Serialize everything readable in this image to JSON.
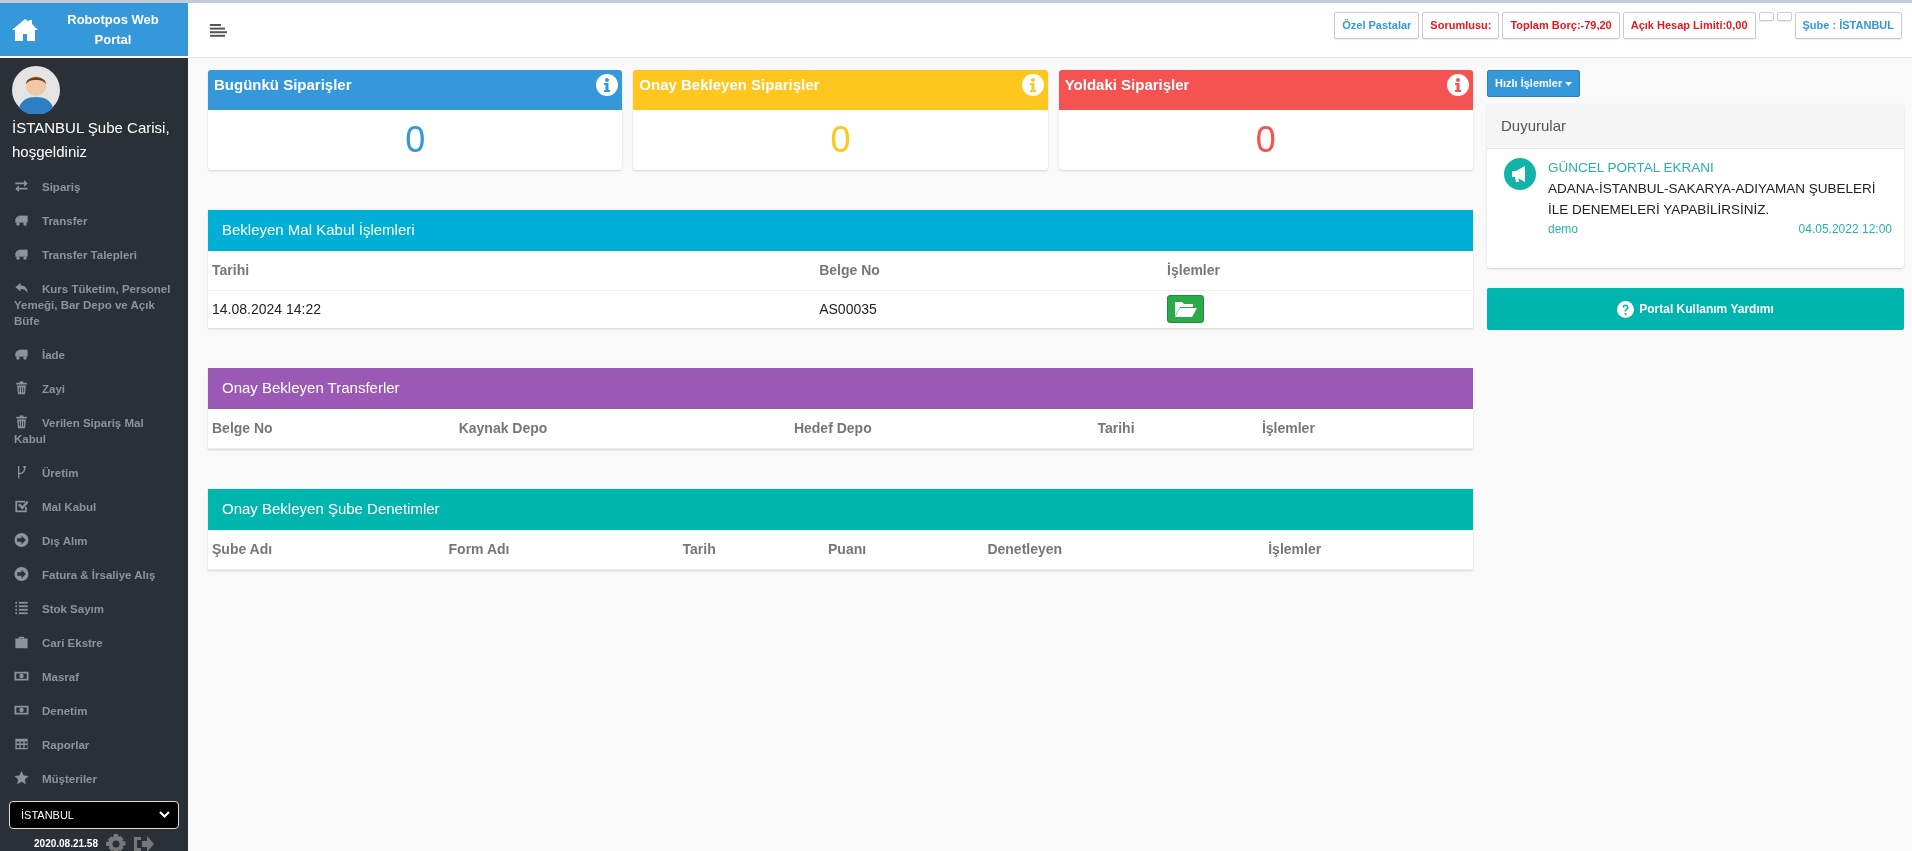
{
  "brand": {
    "title": "Robotpos Web Portal"
  },
  "profile": {
    "greeting": "İSTANBUL Şube Carisi, hoşgeldiniz"
  },
  "sidebar": {
    "items": [
      {
        "label": "Sipariş"
      },
      {
        "label": "Transfer"
      },
      {
        "label": "Transfer Talepleri"
      },
      {
        "label": "Kurs Tüketim, Personel Yemeği, Bar Depo ve Açık Büfe"
      },
      {
        "label": "İade"
      },
      {
        "label": "Zayi"
      },
      {
        "label": "Verilen Sipariş Mal Kabul"
      },
      {
        "label": "Üretim"
      },
      {
        "label": "Mal Kabul"
      },
      {
        "label": "Dış Alım"
      },
      {
        "label": "Fatura & İrsaliye Alış"
      },
      {
        "label": "Stok Sayım"
      },
      {
        "label": "Cari Ekstre"
      },
      {
        "label": "Masraf"
      },
      {
        "label": "Denetim"
      },
      {
        "label": "Raporlar"
      },
      {
        "label": "Müşteriler"
      }
    ],
    "branch_select": {
      "value": "İSTANBUL"
    },
    "version": "2020.08.21.58"
  },
  "header": {
    "buttons": [
      {
        "label": "Özel Pastalar",
        "kind": "info"
      },
      {
        "label": "Sorumlusu:",
        "kind": "alert"
      },
      {
        "label": "Toplam Borç:-79,20",
        "kind": "alert"
      },
      {
        "label": "Açık Hesap Limiti:0,00",
        "kind": "alert"
      },
      {
        "kind": "blank"
      },
      {
        "kind": "blank"
      },
      {
        "label": "Şube : İSTANBUL",
        "kind": "info"
      }
    ]
  },
  "stat_cards": [
    {
      "title": "Bugünkü Siparişler",
      "value": "0",
      "color": "#3498db"
    },
    {
      "title": "Onay Bekleyen Siparişler",
      "value": "0",
      "color": "#ffc61f"
    },
    {
      "title": "Yoldaki Siparişler",
      "value": "0",
      "color": "#f55252"
    }
  ],
  "tables": [
    {
      "title": "Bekleyen Mal Kabul İşlemleri",
      "color": "#00afd5",
      "columns": [
        "Tarihi",
        "Belge No",
        "İşlemler"
      ],
      "rows": [
        {
          "cells": [
            "14.08.2024 14:22",
            "AS00035"
          ]
        }
      ]
    },
    {
      "title": "Onay Bekleyen Transferler",
      "color": "#9b59b6",
      "columns": [
        "Belge No",
        "Kaynak Depo",
        "Hedef Depo",
        "Tarihi",
        "İşlemler"
      ]
    },
    {
      "title": "Onay Bekleyen Şube Denetimler",
      "color": "#00b5ad",
      "columns": [
        "Şube Adı",
        "Form Adı",
        "Tarih",
        "Puanı",
        "Denetleyen",
        "İşlemler"
      ]
    }
  ],
  "quick_actions": {
    "label": "Hızlı İşlemler"
  },
  "announcements": {
    "title": "Duyurular",
    "items": [
      {
        "heading": "GÜNCEL PORTAL EKRANI",
        "body": "ADANA-İSTANBUL-SAKARYA-ADIYAMAN ŞUBELERİ İLE DENEMELERİ YAPABİLİRSİNİZ.",
        "author": "demo",
        "date": "04.05.2022 12:00"
      }
    ]
  },
  "help_button": {
    "label": "Portal Kullanım Yardımı"
  }
}
